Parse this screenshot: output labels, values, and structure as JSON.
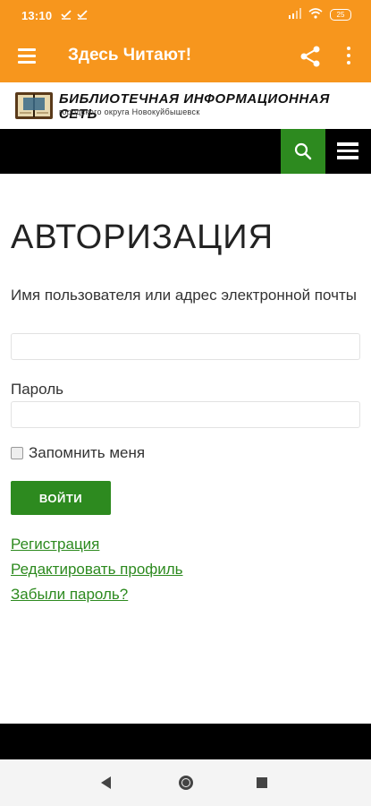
{
  "status": {
    "time": "13:10",
    "notif_icons": [
      "download-done-icon",
      "download-done-icon"
    ],
    "battery": "25"
  },
  "appbar": {
    "title": "Здесь Читают!",
    "bg_color": "#f7961d"
  },
  "site": {
    "logo_title": "БИБЛИОТЕЧНАЯ ИНФОРМАЦИОННАЯ СЕТЬ",
    "logo_subtitle": "городского округа Новокуйбышевск"
  },
  "page": {
    "title": "АВТОРИЗАЦИЯ",
    "username_label": "Имя пользователя или адрес электронной почты",
    "password_label": "Пароль",
    "remember_label": "Запомнить меня",
    "login_button": "ВОЙТИ",
    "links": {
      "register": "Регистрация",
      "edit_profile": "Редактировать профиль",
      "forgot_password": "Забыли пароль?"
    }
  },
  "colors": {
    "accent_green": "#2d8a1f",
    "nav_black": "#000000"
  }
}
